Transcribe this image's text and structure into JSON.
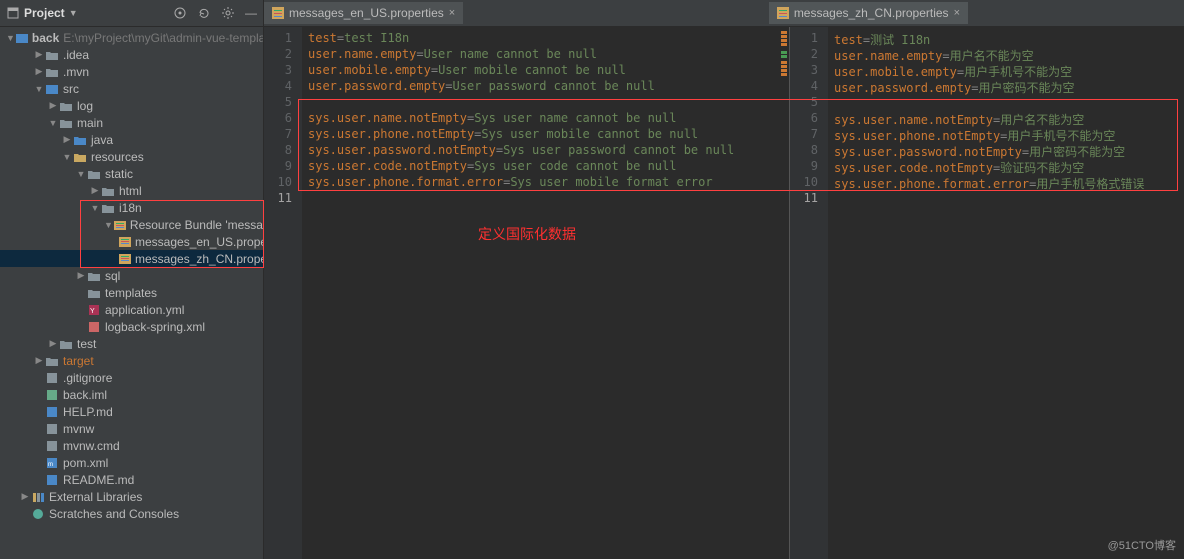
{
  "toolbar": {
    "title": "Project",
    "icons": [
      "target",
      "refresh",
      "gear",
      "minimize"
    ]
  },
  "tree": {
    "root": {
      "name": "back",
      "path": "E:\\myProject\\myGit\\admin-vue-template"
    },
    "nodes": [
      {
        "depth": 1,
        "arrow": "▶",
        "type": "dir",
        "label": ".idea"
      },
      {
        "depth": 1,
        "arrow": "▶",
        "type": "dir",
        "label": ".mvn"
      },
      {
        "depth": 1,
        "arrow": "▼",
        "type": "mod",
        "label": "src"
      },
      {
        "depth": 2,
        "arrow": "▶",
        "type": "dir",
        "label": "log"
      },
      {
        "depth": 2,
        "arrow": "▼",
        "type": "dir",
        "label": "main"
      },
      {
        "depth": 3,
        "arrow": "▶",
        "type": "src",
        "label": "java"
      },
      {
        "depth": 3,
        "arrow": "▼",
        "type": "res",
        "label": "resources"
      },
      {
        "depth": 4,
        "arrow": "▼",
        "type": "dir",
        "label": "static"
      },
      {
        "depth": 5,
        "arrow": "▶",
        "type": "dir",
        "label": "html"
      },
      {
        "depth": 5,
        "arrow": "▼",
        "type": "dir",
        "label": "i18n"
      },
      {
        "depth": 6,
        "arrow": "▼",
        "type": "bundle",
        "label": "Resource Bundle 'message"
      },
      {
        "depth": 7,
        "arrow": "",
        "type": "props",
        "label": "messages_en_US.prope"
      },
      {
        "depth": 7,
        "arrow": "",
        "type": "props",
        "label": "messages_zh_CN.prope",
        "selected": true
      },
      {
        "depth": 4,
        "arrow": "▶",
        "type": "dir",
        "label": "sql"
      },
      {
        "depth": 4,
        "arrow": "",
        "type": "dir",
        "label": "templates"
      },
      {
        "depth": 4,
        "arrow": "",
        "type": "yml",
        "label": "application.yml"
      },
      {
        "depth": 4,
        "arrow": "",
        "type": "xml",
        "label": "logback-spring.xml"
      },
      {
        "depth": 2,
        "arrow": "▶",
        "type": "dir",
        "label": "test"
      },
      {
        "depth": 1,
        "arrow": "▶",
        "type": "dir",
        "label": "target",
        "orange": true
      },
      {
        "depth": 1,
        "arrow": "",
        "type": "file",
        "label": ".gitignore"
      },
      {
        "depth": 1,
        "arrow": "",
        "type": "iml",
        "label": "back.iml"
      },
      {
        "depth": 1,
        "arrow": "",
        "type": "md",
        "label": "HELP.md"
      },
      {
        "depth": 1,
        "arrow": "",
        "type": "file",
        "label": "mvnw"
      },
      {
        "depth": 1,
        "arrow": "",
        "type": "file",
        "label": "mvnw.cmd"
      },
      {
        "depth": 1,
        "arrow": "",
        "type": "mvn",
        "label": "pom.xml"
      },
      {
        "depth": 1,
        "arrow": "",
        "type": "md",
        "label": "README.md"
      },
      {
        "depth": 0,
        "arrow": "▶",
        "type": "lib",
        "label": "External Libraries"
      },
      {
        "depth": 0,
        "arrow": "",
        "type": "scratch",
        "label": "Scratches and Consoles"
      }
    ]
  },
  "tabs": {
    "left": "messages_en_US.properties",
    "right": "messages_zh_CN.properties"
  },
  "editor_left": {
    "lines": [
      {
        "n": 1,
        "k": "test",
        "v": "test I18n"
      },
      {
        "n": 2,
        "k": "user.name.empty",
        "v": "User name cannot be null"
      },
      {
        "n": 3,
        "k": "user.mobile.empty",
        "v": "User mobile cannot be null"
      },
      {
        "n": 4,
        "k": "user.password.empty",
        "v": "User password cannot be null"
      },
      {
        "n": 5,
        "blank": true
      },
      {
        "n": 6,
        "k": "sys.user.name.notEmpty",
        "v": "Sys user name cannot be null"
      },
      {
        "n": 7,
        "k": "sys.user.phone.notEmpty",
        "v": "Sys user mobile cannot be null"
      },
      {
        "n": 8,
        "k": "sys.user.password.notEmpty",
        "v": "Sys user password cannot be null"
      },
      {
        "n": 9,
        "k": "sys.user.code.notEmpty",
        "v": "Sys user code cannot be null"
      },
      {
        "n": 10,
        "k": "sys.user.phone.format.error",
        "v": "Sys user mobile format error"
      },
      {
        "n": 11,
        "blank": true,
        "cursor": true
      }
    ]
  },
  "editor_right": {
    "lines": [
      {
        "n": 1,
        "k": "test",
        "v": "测试 I18n"
      },
      {
        "n": 2,
        "k": "user.name.empty",
        "v": "用户名不能为空"
      },
      {
        "n": 3,
        "k": "user.mobile.empty",
        "v": "用户手机号不能为空"
      },
      {
        "n": 4,
        "k": "user.password.empty",
        "v": "用户密码不能为空"
      },
      {
        "n": 5,
        "blank": true
      },
      {
        "n": 6,
        "k": "sys.user.name.notEmpty",
        "v": "用户名不能为空"
      },
      {
        "n": 7,
        "k": "sys.user.phone.notEmpty",
        "v": "用户手机号不能为空"
      },
      {
        "n": 8,
        "k": "sys.user.password.notEmpty",
        "v": "用户密码不能为空"
      },
      {
        "n": 9,
        "k": "sys.user.code.notEmpty",
        "v": "验证码不能为空"
      },
      {
        "n": 10,
        "k": "sys.user.phone.format.error",
        "v": "用户手机号格式错误"
      },
      {
        "n": 11,
        "blank": true,
        "cursor": true
      }
    ]
  },
  "annotation": "定义国际化数据",
  "watermark": "@51CTO博客"
}
